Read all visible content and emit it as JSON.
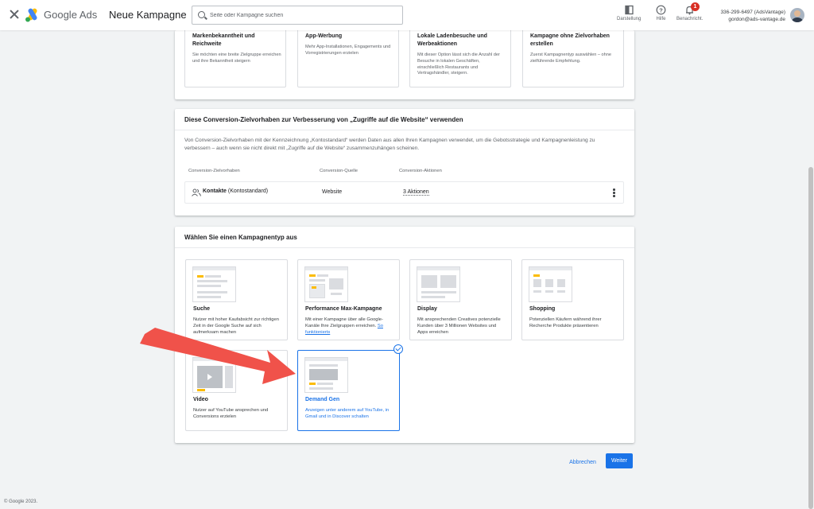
{
  "header": {
    "brand": "Google Ads",
    "campaign_title": "Neue Kampagne",
    "search_placeholder": "Seite oder Kampagne suchen",
    "appearance_label": "Darstellung",
    "help_label": "Hilfe",
    "notifications_label": "Benachricht.",
    "notification_count": "1",
    "account_id": "336-299-6497 (AdsVantage)",
    "account_email": "gordon@ads-vantage.de"
  },
  "goals": [
    {
      "title": "Markenbekanntheit und Reichweite",
      "desc": "Sie möchten eine breite Zielgruppe erreichen und ihre Bekanntheit steigern"
    },
    {
      "title": "App-Werbung",
      "desc": "Mehr App-Installationen, Engagements und Vorregistrierungen erzielen"
    },
    {
      "title": "Lokale Ladenbesuche und Werbeaktionen",
      "desc": "Mit dieser Option lässt sich die Anzahl der Besuche in lokalen Geschäften, einschließlich Restaurants und Vertragshändler, steigern."
    },
    {
      "title": "Kampagne ohne Zielvorhaben erstellen",
      "desc": "Zuerst Kampagnentyp auswählen – ohne zielführende Empfehlung."
    }
  ],
  "conversion": {
    "title": "Diese Conversion-Zielvorhaben zur Verbesserung von „Zugriffe auf die Website“ verwenden",
    "description": "Von Conversion-Zielvorhaben mit der Kennzeichnung „Kontostandard“ werden Daten aus allen Ihren Kampagnen verwendet, um die Gebotsstrategie und Kampagnenleistung zu verbessern – auch wenn sie nicht direkt mit „Zugriffe auf die Website“ zusammenzuhängen scheinen.",
    "col_goal": "Conversion-Zielvorhaben",
    "col_source": "Conversion-Quelle",
    "col_actions": "Conversion-Aktionen",
    "row_name": "Kontakte",
    "row_tag": "(Kontostandard)",
    "row_source": "Website",
    "row_actions": "3 Aktionen"
  },
  "campaign_types": {
    "title": "Wählen Sie einen Kampagnentyp aus",
    "items": [
      {
        "name": "Suche",
        "desc": "Nutzer mit hoher Kaufabsicht zur richtigen Zeit in der Google Suche auf sich aufmerksam machen"
      },
      {
        "name": "Performance Max-Kampagne",
        "desc": "Mit einer Kampagne über alle Google-Kanäle Ihre Zielgruppen erreichen.",
        "link": "So funktionierts"
      },
      {
        "name": "Display",
        "desc": "Mit ansprechenden Creatives potenzielle Kunden über 3 Millionen Websites und Apps erreichen"
      },
      {
        "name": "Shopping",
        "desc": "Potenziellen Käufern während ihrer Recherche Produkte präsentieren"
      },
      {
        "name": "Video",
        "desc": "Nutzer auf YouTube ansprechen und Conversions erzielen"
      },
      {
        "name": "Demand Gen",
        "desc": "Anzeigen unter anderem auf YouTube, in Gmail und in Discover schalten",
        "selected": true
      }
    ]
  },
  "actions": {
    "cancel": "Abbrechen",
    "next": "Weiter"
  },
  "footer": "© Google 2023.",
  "colors": {
    "accent": "#1a73e8",
    "arrow": "#f0524a",
    "badge": "#d93025"
  }
}
